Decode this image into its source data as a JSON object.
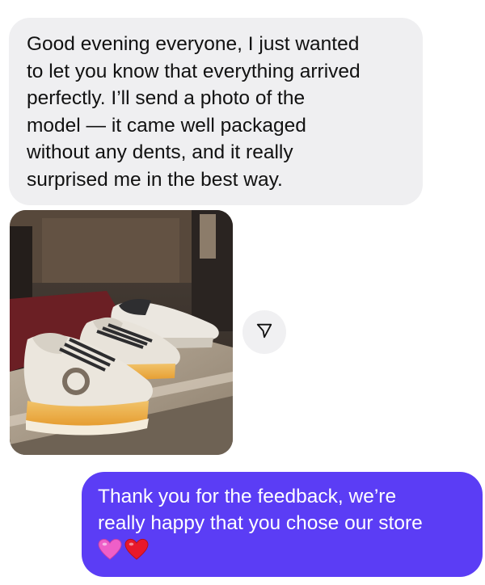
{
  "messages": {
    "incoming": {
      "lines": [
        "Good evening everyone, I just wanted",
        "to let you know that everything arrived",
        "perfectly. I’ll send a photo of the",
        "model — it came well packaged",
        "without any dents, and it really",
        "surprised me in the best way."
      ],
      "photo_icon": "sneakers-photo"
    },
    "share_icon": "send-arrow-icon",
    "outgoing": {
      "lines": [
        "Thank you for the feedback, we’re",
        "really happy that you chose our store"
      ],
      "emojis": [
        "pink-heart-icon",
        "red-heart-icon"
      ]
    }
  },
  "colors": {
    "incoming_bubble": "#efeff1",
    "outgoing_bubble": "#5b3df5",
    "incoming_text": "#111111",
    "outgoing_text": "#ffffff",
    "pink_heart": "#ee5fc8",
    "red_heart": "#e8182b"
  }
}
